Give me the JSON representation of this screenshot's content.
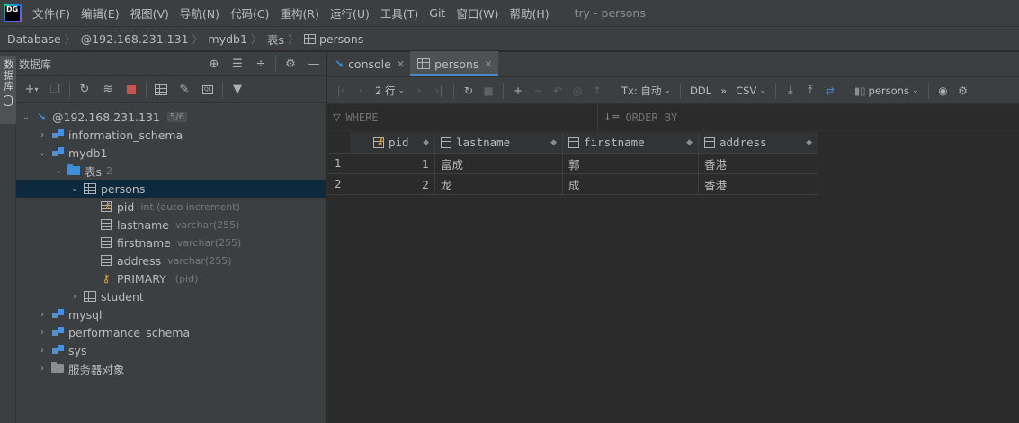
{
  "app": {
    "logo_text": "DG",
    "window_title": "try - persons"
  },
  "menu": [
    "文件(F)",
    "编辑(E)",
    "视图(V)",
    "导航(N)",
    "代码(C)",
    "重构(R)",
    "运行(U)",
    "工具(T)",
    "Git",
    "窗口(W)",
    "帮助(H)"
  ],
  "breadcrumb": [
    "Database",
    "@192.168.231.131",
    "mydb1",
    "表s",
    "persons"
  ],
  "tool_stripe": {
    "label": "数据库"
  },
  "db_panel": {
    "title": "数据库",
    "header_icons": [
      "crosshair-icon",
      "collapse-all-icon",
      "expand-all-icon",
      "gear-icon",
      "minimize-icon"
    ],
    "toolbar_icons": [
      "add-icon",
      "copy-icon",
      "refresh-icon",
      "edit-properties-icon",
      "stop-icon",
      "table-icon",
      "edit-icon",
      "query-console-icon",
      "filter-icon"
    ]
  },
  "tree": {
    "connection": {
      "label": "@192.168.231.131",
      "badge": "5/6"
    },
    "information_schema": "information_schema",
    "mydb1": "mydb1",
    "tables_folder": {
      "label": "表s",
      "count": "2"
    },
    "persons": "persons",
    "columns": [
      {
        "name": "pid",
        "type": "int (auto increment)"
      },
      {
        "name": "lastname",
        "type": "varchar(255)"
      },
      {
        "name": "firstname",
        "type": "varchar(255)"
      },
      {
        "name": "address",
        "type": "varchar(255)"
      }
    ],
    "primary": {
      "name": "PRIMARY",
      "meta": "(pid)"
    },
    "student": "student",
    "mysql": "mysql",
    "performance_schema": "performance_schema",
    "sys": "sys",
    "server_objects": "服务器对象"
  },
  "tabs": [
    {
      "label": "console",
      "icon": "console-icon"
    },
    {
      "label": "persons",
      "icon": "table-icon",
      "active": true
    }
  ],
  "grid_toolbar": {
    "rows_label": "2 行",
    "tx_label": "Tx: 自动",
    "ddl_label": "DDL",
    "more_label": "»",
    "csv_label": "CSV",
    "session_label": "persons"
  },
  "filter": {
    "where": "WHERE",
    "order_by": "ORDER BY"
  },
  "table": {
    "columns": [
      "pid",
      "lastname",
      "firstname",
      "address"
    ],
    "rows": [
      {
        "num": "1",
        "pid": "1",
        "lastname": "富成",
        "firstname": "郭",
        "address": "香港"
      },
      {
        "num": "2",
        "pid": "2",
        "lastname": "龙",
        "firstname": "成",
        "address": "香港"
      }
    ]
  },
  "colors": {
    "accent": "#4a88c7",
    "selection": "#0d293e",
    "key": "#e8a93a"
  }
}
